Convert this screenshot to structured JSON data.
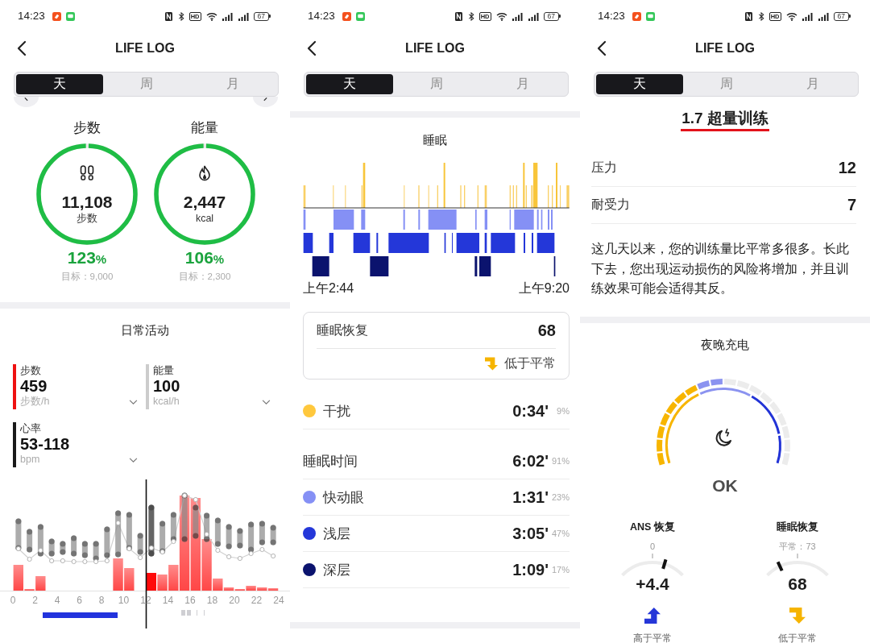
{
  "screens": [
    {
      "kind": "activity",
      "status_bar": {
        "time": "14:23",
        "hd": "HD",
        "battery": "67"
      },
      "title": "LIFE LOG",
      "tabs": [
        {
          "label": "天",
          "selected": true
        },
        {
          "label": "周",
          "selected": false
        },
        {
          "label": "月",
          "selected": false
        }
      ],
      "rings": [
        {
          "kind": "steps",
          "title": "步数",
          "value": "11,108",
          "unit": "步数",
          "level": 1,
          "percent": "123",
          "percent_unit": "%",
          "goal": "目标：9,000"
        },
        {
          "kind": "energy",
          "title": "能量",
          "value": "2,447",
          "unit": "kcal",
          "level": 1,
          "percent": "106",
          "percent_unit": "%",
          "goal": "目标：2,300"
        }
      ],
      "daily_activity": {
        "title": "日常活动",
        "metrics": [
          {
            "label": "步数",
            "value": "459",
            "unit": "步数/h",
            "color": "#ee1111"
          },
          {
            "label": "能量",
            "value": "100",
            "unit": "kcal/h",
            "color": "#cccccc"
          },
          {
            "label": "心率",
            "value": "53-118",
            "unit": "bpm",
            "color": "#1a1a1a"
          }
        ],
        "x_labels": [
          "0",
          "2",
          "4",
          "6",
          "8",
          "10",
          "12",
          "14",
          "16",
          "18",
          "20",
          "22",
          "24"
        ]
      }
    },
    {
      "kind": "sleep",
      "status_bar": {
        "time": "14:23",
        "hd": "HD",
        "battery": "67"
      },
      "title": "LIFE LOG",
      "tabs": [
        {
          "label": "天",
          "selected": true
        },
        {
          "label": "周",
          "selected": false
        },
        {
          "label": "月",
          "selected": false
        }
      ],
      "sleep": {
        "title": "睡眠",
        "start_time": "上午2:44",
        "end_time": "上午9:20"
      },
      "recovery": {
        "label": "睡眠恢复",
        "value": "68",
        "above_normal": false,
        "trend_label": "低于平常"
      },
      "phases": [
        {
          "kind": "interruption",
          "label": "干扰",
          "color": "#ffc83d",
          "duration": "0:34'",
          "share": "9%"
        },
        {
          "kind": "total",
          "label": "睡眠时间",
          "duration": "6:02'",
          "share": "91%"
        },
        {
          "kind": "stage",
          "label": "快动眼",
          "color": "#8590f5",
          "duration": "1:31'",
          "share": "23%"
        },
        {
          "kind": "stage",
          "label": "浅层",
          "color": "#2437d9",
          "duration": "3:05'",
          "share": "47%"
        },
        {
          "kind": "stage",
          "label": "深层",
          "color": "#0b136e",
          "duration": "1:09'",
          "share": "17%"
        }
      ]
    },
    {
      "kind": "training",
      "status_bar": {
        "time": "14:23",
        "hd": "HD",
        "battery": "67"
      },
      "title": "LIFE LOG",
      "tabs": [
        {
          "label": "天",
          "selected": true
        },
        {
          "label": "周",
          "selected": false
        },
        {
          "label": "月",
          "selected": false
        }
      ],
      "training": {
        "title": "1.7 超量训练",
        "stats": [
          {
            "label": "压力",
            "value": "12"
          },
          {
            "label": "耐受力",
            "value": "7"
          }
        ],
        "description": "这几天以来，您的训练量比平常多很多。长此下去，您出现运动损伤的风险将增加，并且训练效果可能会适得其反。"
      },
      "nightly_recharge": {
        "title": "夜晚充电",
        "status": "OK",
        "gauges": [
          {
            "title": "ANS 恢复",
            "reference": "0",
            "value": "+4.4",
            "level": 0.68,
            "above_normal": true,
            "trend_label": "高于平常"
          },
          {
            "title": "睡眠恢复",
            "reference": "平常：73",
            "value": "68",
            "level": 0.23,
            "above_normal": false,
            "trend_label": "低于平常"
          }
        ]
      }
    }
  ]
}
